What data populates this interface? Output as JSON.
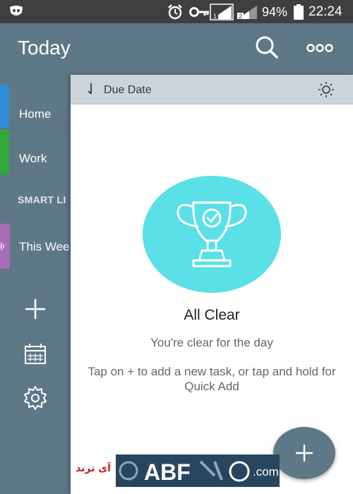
{
  "status_bar": {
    "battery": "94%",
    "time": "22:24",
    "sim1": "1",
    "sim2": "2"
  },
  "header": {
    "title": "Today"
  },
  "sidebar": {
    "lists": [
      {
        "label": "Home",
        "color": "#2f8cd6"
      },
      {
        "label": "Work",
        "color": "#32a73a"
      }
    ],
    "smart_lists_heading": "SMART LI",
    "smart_lists": [
      {
        "label": "This Wee",
        "color": "#a86db5",
        "icon": "gear-icon"
      }
    ],
    "actions": [
      "add-icon",
      "calendar-icon",
      "settings-icon"
    ]
  },
  "sort_bar": {
    "label": "Due Date",
    "icon": "sort-down-icon",
    "theme_icon": "sun-icon"
  },
  "empty_state": {
    "title": "All Clear",
    "subtitle": "You're clear for the day",
    "hint": "Tap on + to add a new task, or tap and hold for Quick Add",
    "circle_color": "#5ae0e6"
  },
  "watermark": {
    "persian_text": "آی ترند",
    "letters": "ABF",
    "domain": ".com"
  },
  "colors": {
    "primary": "#5f7888",
    "status_bar": "#3d3f41",
    "sort_bar": "#ccd4d9"
  }
}
